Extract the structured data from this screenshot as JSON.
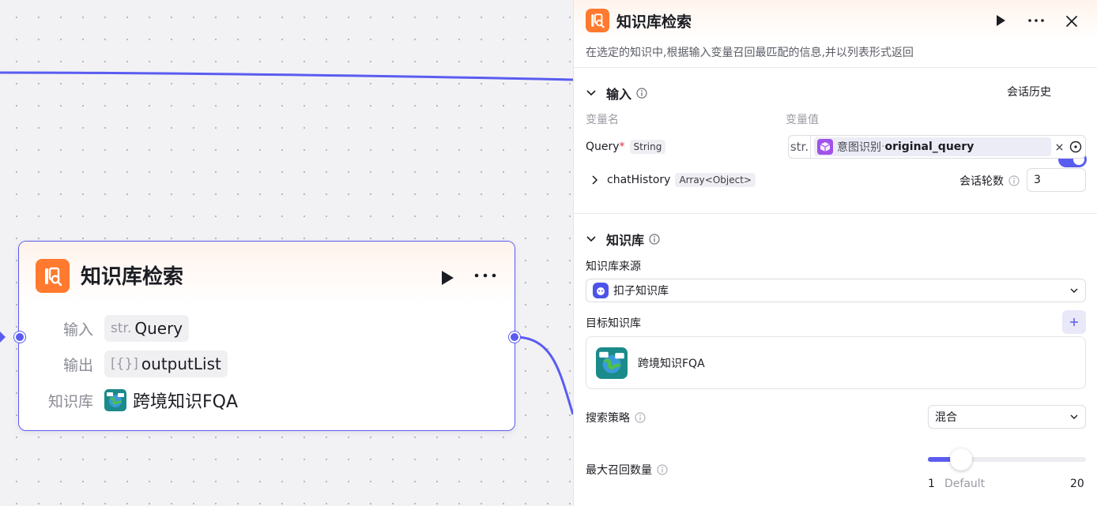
{
  "node": {
    "title": "知识库检索",
    "rows": {
      "input_label": "输入",
      "input_type": "str.",
      "input_value": "Query",
      "output_label": "输出",
      "output_type": "[{}]",
      "output_value": "outputList",
      "kb_label": "知识库",
      "kb_value": "跨境知识FQA"
    }
  },
  "panel": {
    "title": "知识库检索",
    "description": "在选定的知识中,根据输入变量召回最匹配的信息,并以列表形式返回",
    "input_section": {
      "title": "输入",
      "history_label": "会话历史",
      "history_enabled": true,
      "col_name": "变量名",
      "col_value": "变量值",
      "query_name": "Query",
      "query_required_mark": "*",
      "query_type": "String",
      "query_ref_prefix": "str.",
      "query_ref_node": "意图识别",
      "query_ref_sep": " · ",
      "query_ref_var": "original_query",
      "history_name": "chatHistory",
      "history_type": "Array<Object>",
      "rounds_label": "会话轮数",
      "rounds_value": "3"
    },
    "kb_section": {
      "title": "知识库",
      "source_label": "知识库来源",
      "source_value": "扣子知识库",
      "target_label": "目标知识库",
      "target_item": "跨境知识FQA",
      "strategy_label": "搜索策略",
      "strategy_value": "混合",
      "max_label": "最大召回数量",
      "slider_min": "1",
      "slider_default": "Default",
      "slider_max": "20",
      "slider_value": 5
    }
  },
  "colors": {
    "accent": "#5a5cf0",
    "kb_orange": "#ff7a2f",
    "intent_purple": "#a052e8"
  }
}
